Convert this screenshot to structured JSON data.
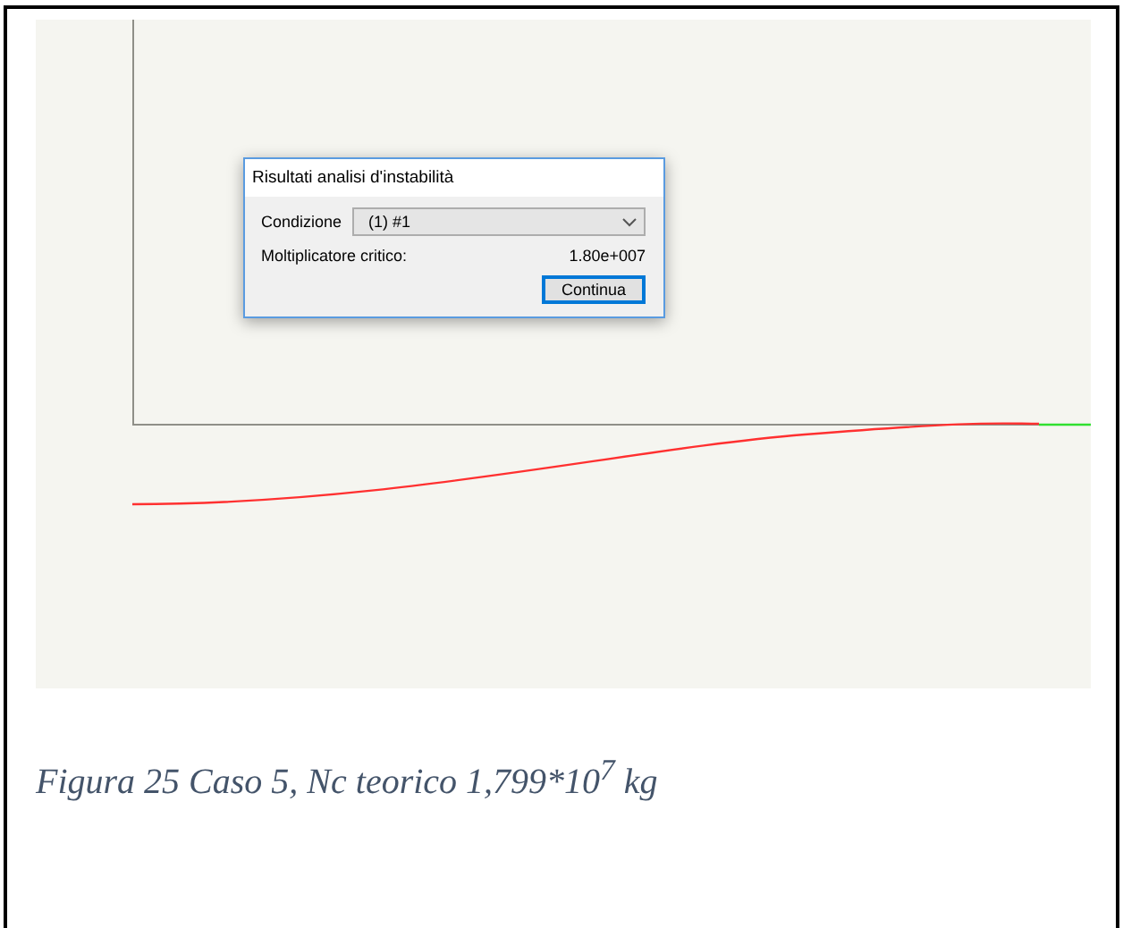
{
  "dialog": {
    "title": "Risultati analisi d'instabilità",
    "condition": {
      "label": "Condizione",
      "value": "(1) #1"
    },
    "result": {
      "label": "Moltiplicatore critico:",
      "value": "1.80e+007"
    },
    "button": "Continua"
  },
  "caption": "Figura 25 Caso 5, Nc teorico 1,799*10$^{7}$ kg"
}
